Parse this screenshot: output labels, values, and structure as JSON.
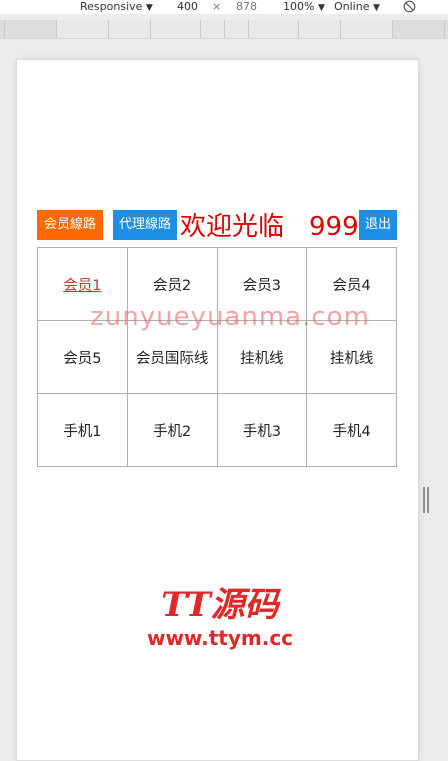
{
  "devtools": {
    "device": "Responsive",
    "width": "400",
    "times": "×",
    "height": "878",
    "zoom": "100%",
    "network": "Online",
    "dropdown_glyph": "▼"
  },
  "page": {
    "member_lines_label": "会员線路",
    "agent_lines_label": "代理線路",
    "welcome": "欢迎光临",
    "member_id": "999",
    "logout_label": "退出"
  },
  "grid": {
    "rows": [
      [
        "会员1",
        "会员2",
        "会员3",
        "会员4"
      ],
      [
        "会员5",
        "会员国际线",
        "挂机线",
        "挂机线"
      ],
      [
        "手机1",
        "手机2",
        "手机3",
        "手机4"
      ]
    ]
  },
  "watermark": "zunyueyuanma.com",
  "logo": {
    "mark": "TT源码",
    "url": "www.ttym.cc"
  },
  "colors": {
    "orange": "#ff6a00",
    "blue": "#1e8fe6",
    "red": "#e00000"
  },
  "icons": {
    "rotate": "rotate-icon"
  }
}
